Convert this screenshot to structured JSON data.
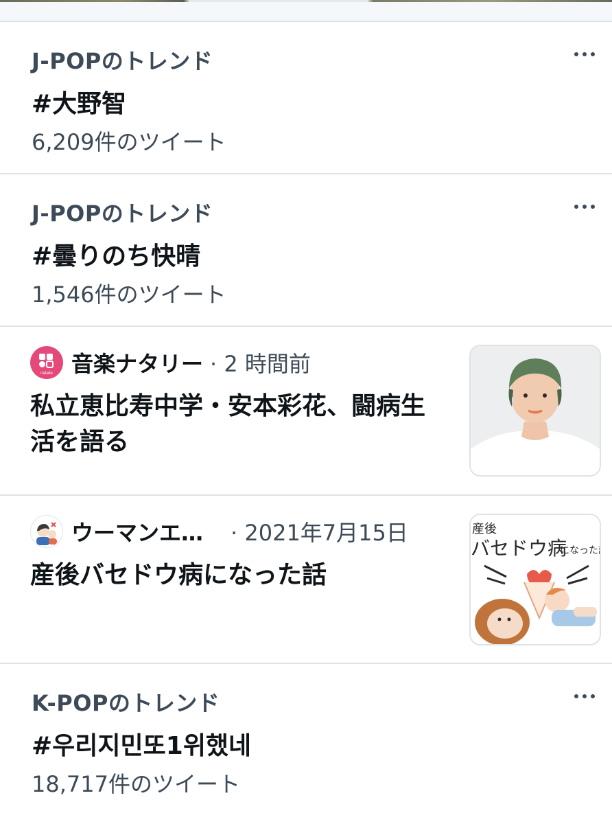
{
  "trends": [
    {
      "category": "J-POPのトレンド",
      "topic": "#大野智",
      "count": "6,209件のツイート",
      "more_icon": "more-horizontal-icon"
    },
    {
      "category": "J-POPのトレンド",
      "topic": "#曇りのち快晴",
      "count": "1,546件のツイート",
      "more_icon": "more-horizontal-icon"
    },
    {
      "category": "K-POPのトレンド",
      "topic": "#우리지민또1위했네",
      "count": "18,717件のツイート",
      "more_icon": "more-horizontal-icon"
    }
  ],
  "news": [
    {
      "source": "音楽ナタリー",
      "time": "· 2 時間前",
      "headline": "私立恵比寿中学・安本彩花、闘病生活を語る",
      "avatar_label": "natalie",
      "thumbnail": "portrait-photo"
    },
    {
      "source": "ウーマンエ…",
      "time": "· 2021年7月15日",
      "headline": "産後バセドウ病になった話",
      "thumbnail": "illustration",
      "thumbnail_text": {
        "line1": "産後",
        "line2": "バセドウ病",
        "line3": "になった話"
      }
    }
  ],
  "colors": {
    "text_primary": "#0f1419",
    "text_secondary": "#3d4a57",
    "divider": "#dfe3e6",
    "natalie_pink": "#e5497a"
  }
}
